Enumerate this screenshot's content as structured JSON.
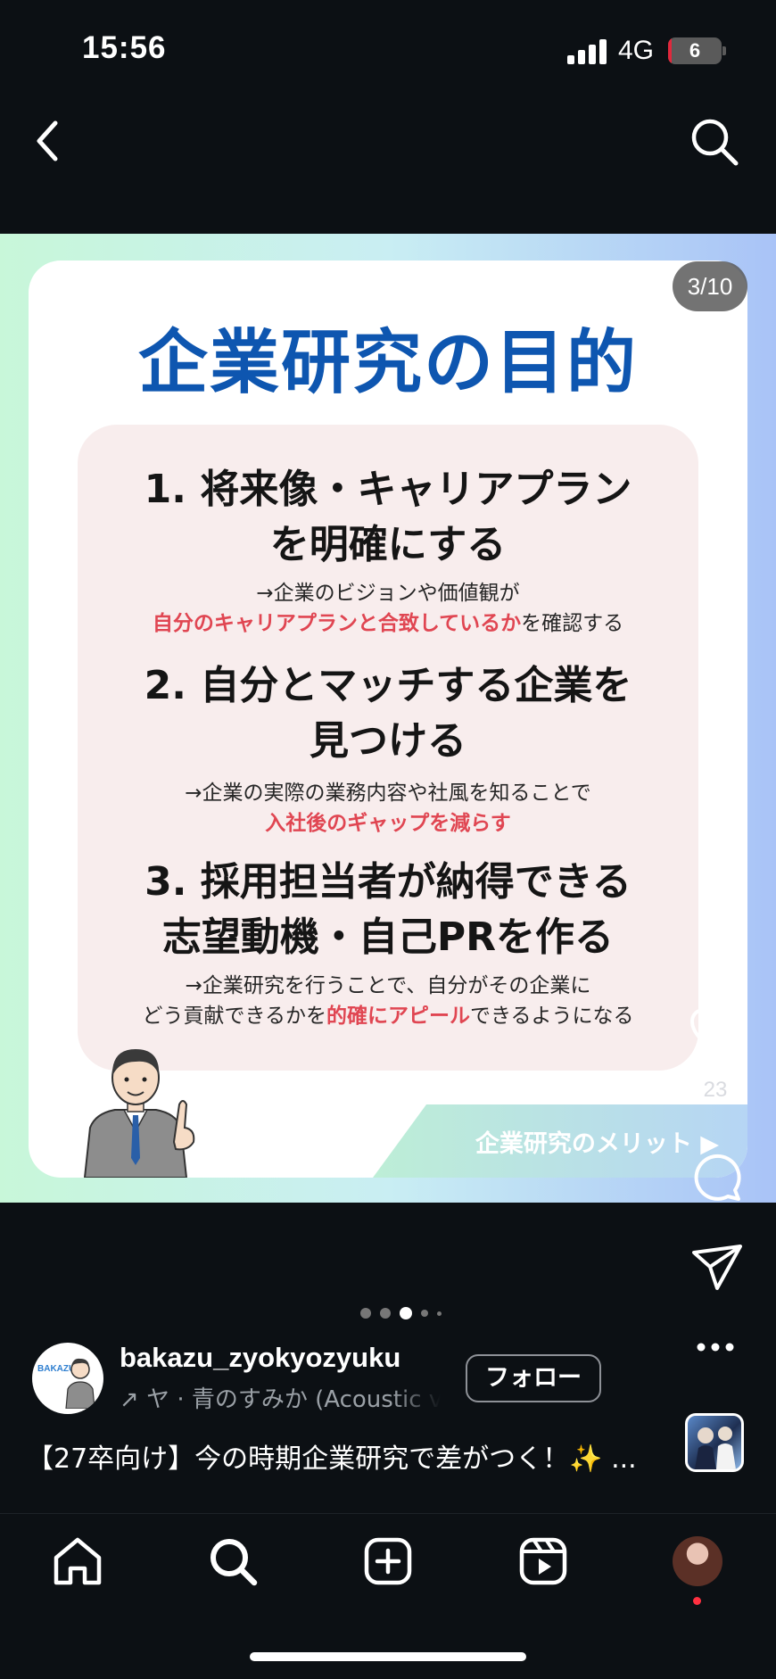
{
  "status_bar": {
    "time": "15:56",
    "network": "4G",
    "battery_level": "6",
    "battery_fraction": 0.06
  },
  "post": {
    "counter": "3/10",
    "slide": {
      "title": "企業研究の目的",
      "items": [
        {
          "heading": "1.  将来像・キャリアプラン\nを明確にする",
          "desc_line1": "→企業のビジョンや価値観が",
          "desc_line2_highlight": "自分のキャリアプランと合致しているか",
          "desc_line2_rest": "を確認する"
        },
        {
          "heading": "2.  自分とマッチする企業を\n見つける",
          "desc_line1": "→企業の実際の業務内容や社風を知ることで",
          "desc_line2_highlight": "入社後のギャップを減らす"
        },
        {
          "heading": "3.  採用担当者が納得できる\n志望動機・自己PRを作る",
          "desc_line1": "→企業研究を行うことで、自分がその企業に",
          "desc_line2_pre": "どう貢献できるかを",
          "desc_line2_highlight": "的確にアピール",
          "desc_line2_rest": "できるようになる"
        }
      ],
      "banner": "企業研究のメリット ▶"
    },
    "like_count": "23"
  },
  "author": {
    "username": "bakazu_zyokyozyuku",
    "avatar_badge": "BAKAZU",
    "music": "↗ ヤ · 青のすみか (Acoustic ver.)",
    "follow_label": "フォロー"
  },
  "caption": "【27卒向け】今の時期企業研究で差がつく！✨ ...",
  "carousel": {
    "count": 5,
    "active_index": 2
  },
  "icons": [
    "back-icon",
    "search-icon",
    "heart-icon",
    "comment-icon",
    "share-icon",
    "more-icon",
    "home-icon",
    "add-icon",
    "reels-icon"
  ],
  "colors": {
    "title_blue": "#0e56b0",
    "highlight_red": "#e04652",
    "background": "#0c1014"
  }
}
